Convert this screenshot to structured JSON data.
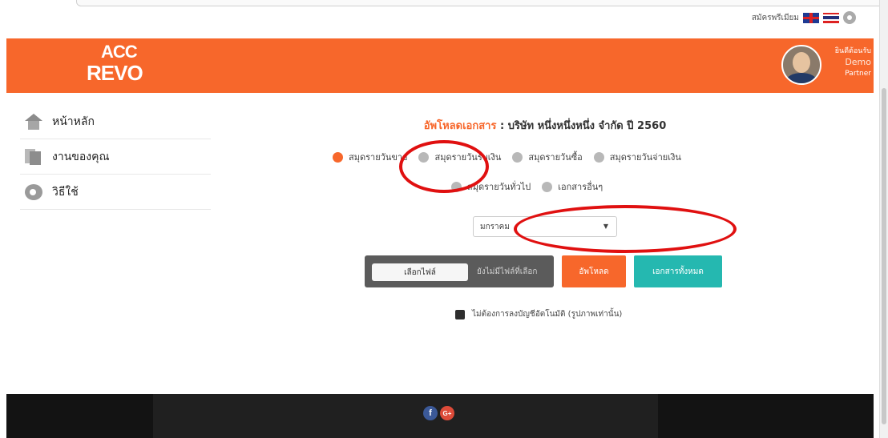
{
  "topbar": {
    "premium_label": "สมัครพรีเมียม"
  },
  "brand": {
    "logo_top": "ACC",
    "logo_bottom": "REVO",
    "accent": "#f7672b",
    "teal": "#25b8b0"
  },
  "user": {
    "welcome": "ยินดีต้อนรับ",
    "name": "Demo",
    "role": "Partner"
  },
  "sidebar": {
    "items": [
      {
        "label": "หน้าหลัก",
        "icon": "home-icon"
      },
      {
        "label": "งานของคุณ",
        "icon": "documents-icon"
      },
      {
        "label": "วิธีใช้",
        "icon": "gear-icon"
      }
    ]
  },
  "upload": {
    "title_prefix": "อัพโหลดเอกสาร",
    "title_company": " : บริษัท หนึ่งหนึ่งหนึ่ง จำกัด ปี 2560",
    "radios_row1": [
      "สมุดรายวันขาย",
      "สมุดรายวันรับเงิน",
      "สมุดรายวันซื้อ",
      "สมุดรายวันจ่ายเงิน"
    ],
    "radios_row2": [
      "สมุดรายวันทั่วไป",
      "เอกสารอื่นๆ"
    ],
    "selected_radio": "สมุดรายวันขาย",
    "month_value": "มกราคม",
    "choose_file": "เลือกไฟล์",
    "no_file": "ยังไม่มีไฟล์ที่เลือก",
    "upload_button": "อัพโหลด",
    "all_docs_button": "เอกสารทั้งหมด",
    "checkbox_label": "ไม่ต้องการลงบัญชีอัตโนมัติ (รูปภาพเท่านั้น)"
  },
  "footer": {
    "social": [
      "facebook-icon",
      "google-plus-icon"
    ],
    "fb": "f",
    "gp": "G+"
  }
}
